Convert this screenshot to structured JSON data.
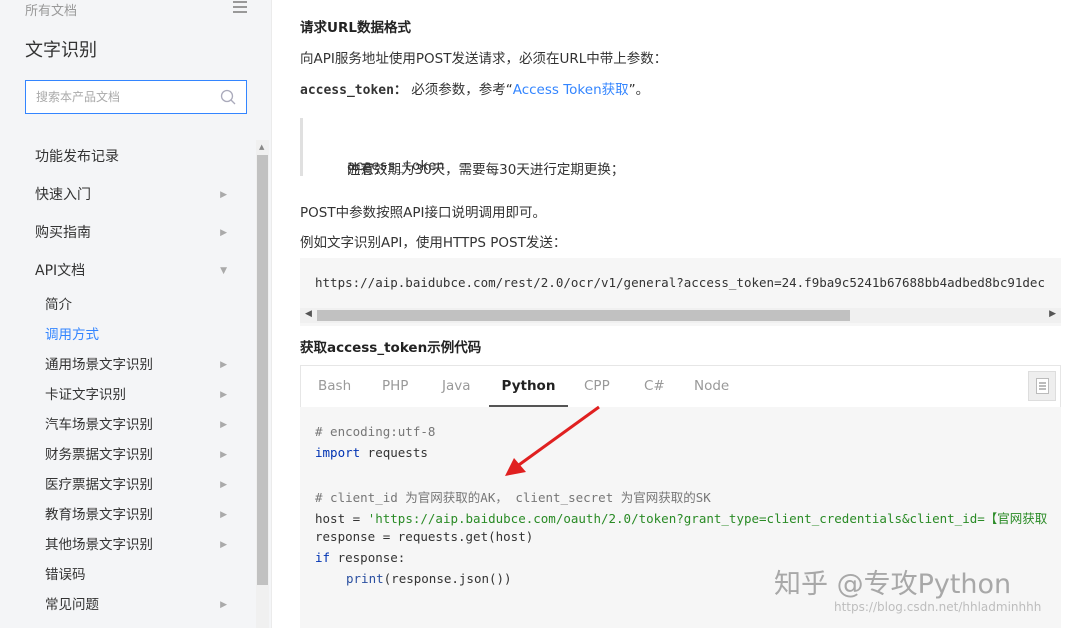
{
  "sidebar": {
    "breadcrumb": "所有文档",
    "doc_title": "文字识别",
    "search_placeholder": "搜索本产品文档",
    "items": [
      {
        "label": "功能发布记录",
        "arrow": ""
      },
      {
        "label": "快速入门",
        "arrow": "▶"
      },
      {
        "label": "购买指南",
        "arrow": "▶"
      },
      {
        "label": "API文档",
        "arrow": "▼"
      }
    ],
    "sub_items": [
      {
        "label": "简介",
        "arrow": ""
      },
      {
        "label": "调用方式",
        "arrow": ""
      },
      {
        "label": "通用场景文字识别",
        "arrow": "▶"
      },
      {
        "label": "卡证文字识别",
        "arrow": "▶"
      },
      {
        "label": "汽车场景文字识别",
        "arrow": "▶"
      },
      {
        "label": "财务票据文字识别",
        "arrow": "▶"
      },
      {
        "label": "医疗票据文字识别",
        "arrow": "▶"
      },
      {
        "label": "教育场景文字识别",
        "arrow": "▶"
      },
      {
        "label": "其他场景文字识别",
        "arrow": "▶"
      },
      {
        "label": "错误码",
        "arrow": ""
      },
      {
        "label": "常见问题",
        "arrow": "▶"
      }
    ],
    "active_sub": "调用方式"
  },
  "main": {
    "heading1": "请求URL数据格式",
    "para1": "向API服务地址使用POST发送请求，必须在URL中带上参数：",
    "access_token_label": "access_token：",
    "access_token_text_before": "必须参数，参考“",
    "access_token_link": "Access Token获取",
    "access_token_text_after": "”。",
    "note_prefix": "注意：",
    "note_code": "access_token",
    "note_suffix": "的有效期为30天，需要每30天进行定期更换；",
    "para2": "POST中参数按照API接口说明调用即可。",
    "para3": "例如文字识别API，使用HTTPS POST发送：",
    "example_url": "https://aip.baidubce.com/rest/2.0/ocr/v1/general?access_token=24.f9ba9c5241b67688bb4adbed8bc91dec",
    "heading2": "获取access_token示例代码",
    "tabs": [
      "Bash",
      "PHP",
      "Java",
      "Python",
      "CPP",
      "C#",
      "Node"
    ],
    "active_tab": "Python",
    "code": {
      "l1": "# encoding:utf-8",
      "l2_kw": "import",
      "l2_rest": " requests",
      "l4": "# client_id 为官网获取的AK， client_secret 为官网获取的SK",
      "l5_var": "host = ",
      "l5_str": "'https://aip.baidubce.com/oauth/2.0/token?grant_type=client_credentials&client_id=【官网获取",
      "l6": "response = requests.get(host)",
      "l7_kw": "if",
      "l7_rest": " response:",
      "l8_fn": "print",
      "l8_rest": "(response.json())"
    }
  },
  "watermark": {
    "zhihu": "知乎 @专攻Python",
    "csdn": "https://blog.csdn.net/hhladminhhh"
  },
  "colors": {
    "accent": "#3385ff",
    "arrow": "#e02020",
    "sidebar_bg": "#f4f5f7",
    "code_bg": "#f6f6f6"
  }
}
